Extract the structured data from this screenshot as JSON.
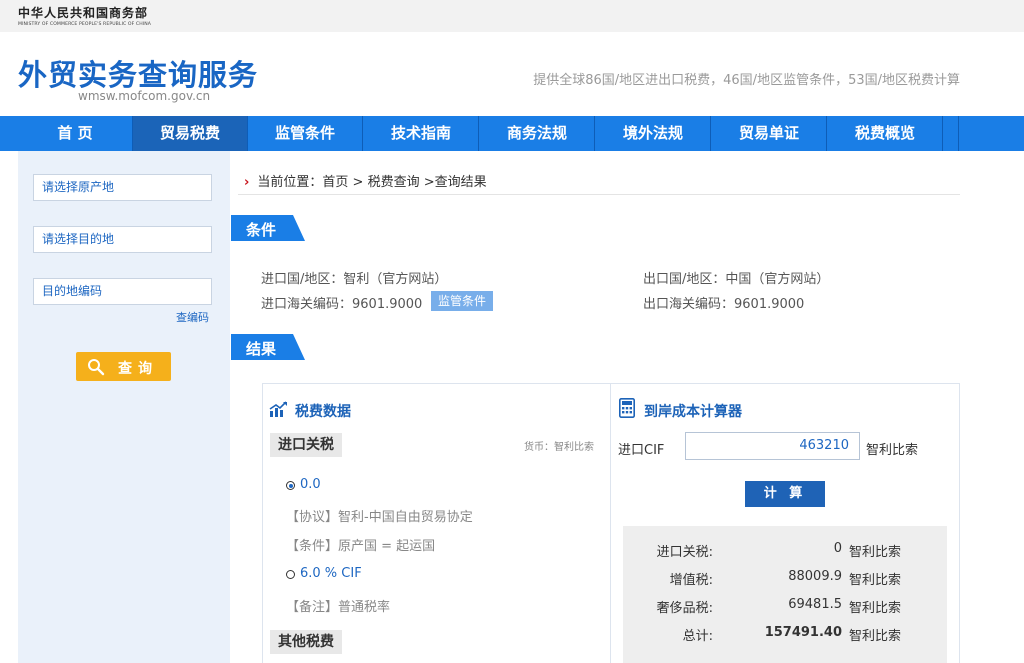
{
  "ministry": {
    "name_cn": "中华人民共和国商务部",
    "name_en": "MINISTRY OF COMMERCE PEOPLE'S REPUBLIC OF CHINA"
  },
  "site": {
    "title": "外贸实务查询服务",
    "domain": "wmsw.mofcom.gov.cn",
    "slogan": "提供全球86国/地区进出口税费，46国/地区监管条件，53国/地区税费计算"
  },
  "nav": {
    "items": [
      "首 页",
      "贸易税费",
      "监管条件",
      "技术指南",
      "商务法规",
      "境外法规",
      "贸易单证",
      "税费概览"
    ],
    "active_index": 1
  },
  "sidebar": {
    "origin_placeholder": "请选择原产地",
    "destination_placeholder": "请选择目的地",
    "code_placeholder": "目的地编码",
    "code_link": "查编码",
    "search_button": "查询"
  },
  "breadcrumb": {
    "label": "当前位置：",
    "items": [
      "首页",
      "税费查询",
      "查询结果"
    ],
    "separator": ">"
  },
  "conditions": {
    "section_title": "条件",
    "import_country": "进口国/地区：智利（官方网站）",
    "export_country": "出口国/地区：中国（官方网站）",
    "import_hs": "进口海关编码：9601.9000",
    "export_hs": "出口海关编码：9601.9000",
    "regulation_badge": "监管条件"
  },
  "results": {
    "section_title": "结果",
    "tax_panel": {
      "title": "税费数据",
      "import_duty_tag": "进口关税",
      "currency_note": "货币：智利比索",
      "options": [
        {
          "rate": "0.0",
          "selected": true,
          "notes": [
            "【协议】智利-中国自由贸易协定",
            "【条件】原产国 = 起运国"
          ]
        },
        {
          "rate": "6.0 % CIF",
          "selected": false,
          "notes": [
            "【备注】普通税率"
          ]
        }
      ],
      "other_tax_tag": "其他税费"
    },
    "calculator": {
      "title": "到岸成本计算器",
      "cif_label": "进口CIF",
      "cif_value": "463210",
      "cif_unit": "智利比索",
      "calc_button": "计 算",
      "rows": [
        {
          "label": "进口关税:",
          "value": "0",
          "unit": "智利比索"
        },
        {
          "label": "增值税:",
          "value": "88009.9",
          "unit": "智利比索"
        },
        {
          "label": "奢侈品税:",
          "value": "69481.5",
          "unit": "智利比索"
        },
        {
          "label": "总计:",
          "value": "157491.40",
          "unit": "智利比索"
        }
      ]
    }
  },
  "colors": {
    "primary": "#1a7ee6",
    "nav_active": "#1b64b8",
    "search_button": "#f5b01b",
    "link": "#1e67c2",
    "badge": "#78aeea"
  },
  "icons": [
    "search-icon",
    "chart-icon",
    "calculator-icon",
    "breadcrumb-arrow-icon"
  ]
}
